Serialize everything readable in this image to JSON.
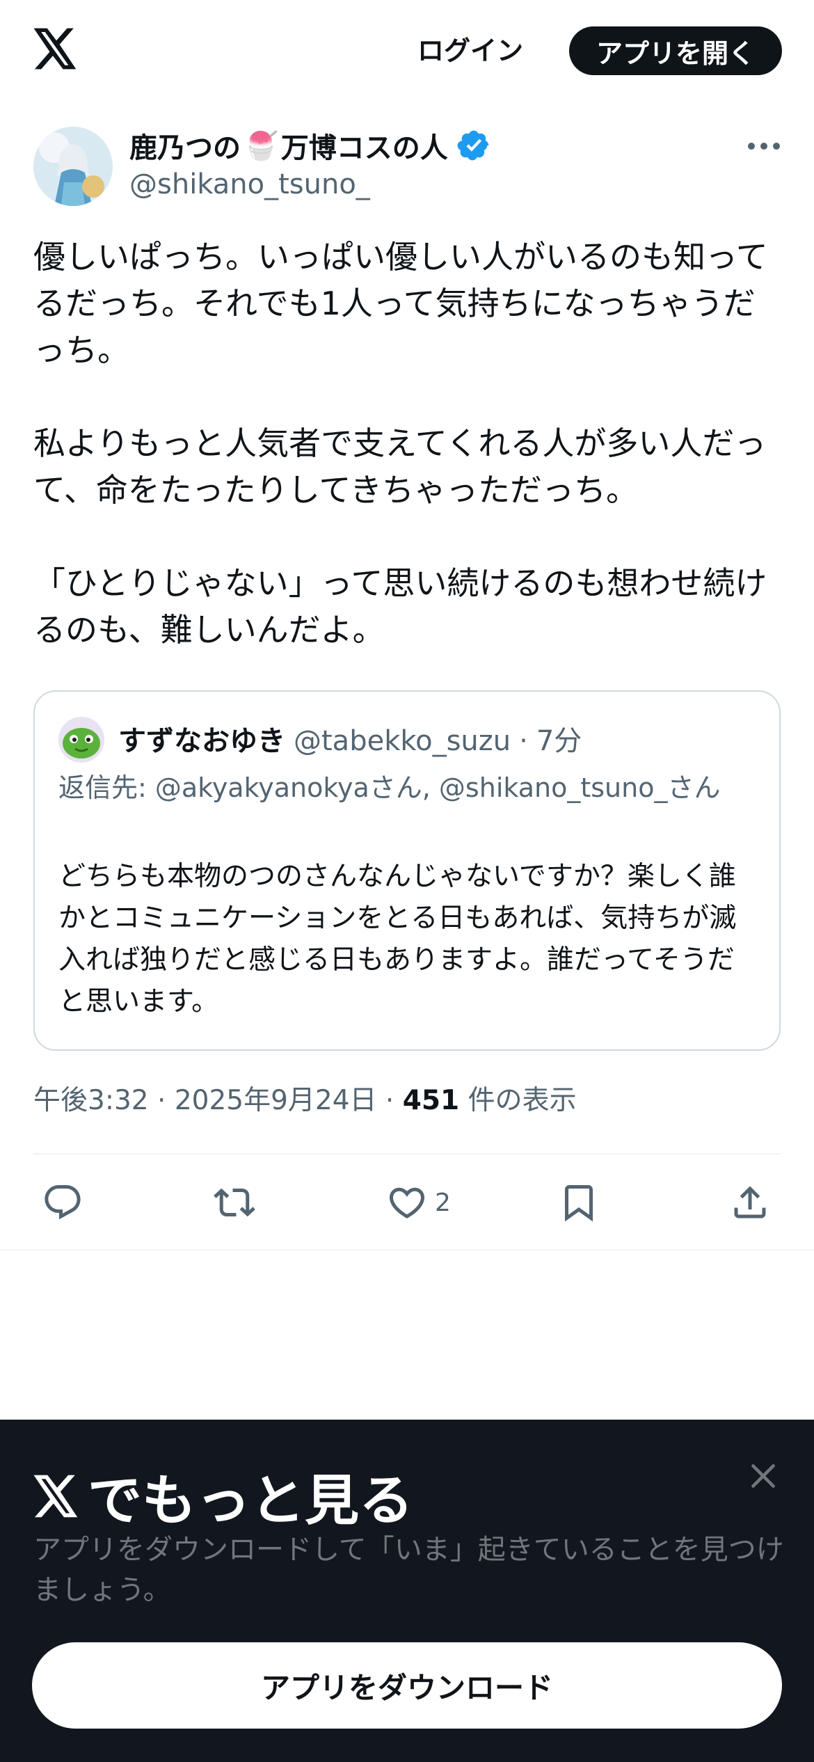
{
  "header": {
    "logo_icon": "x-logo-icon",
    "login_label": "ログイン",
    "open_app_label": "アプリを開く"
  },
  "author": {
    "name_part1": "鹿乃つの",
    "name_emoji": "🍧",
    "name_part2": "万博コスの人",
    "handle": "@shikano_tsuno_",
    "verified_icon": "verified-badge-icon",
    "verified_color": "#1d9bf0"
  },
  "tweet": {
    "text": "優しいぱっち。いっぱい優しい人がいるのも知ってるだっち。それでも1人って気持ちになっちゃうだっち。\n\n私よりもっと人気者で支えてくれる人が多い人だって、命をたったりしてきちゃっただっち。\n\n「ひとりじゃない」って思い続けるのも想わせ続けるのも、難しいんだよ。"
  },
  "quote": {
    "name": "すずなおゆき",
    "handle": "@tabekko_suzu",
    "separator": "·",
    "time": "7分",
    "reply_to": "返信先: @akyakyanokyaさん, @shikano_tsuno_さん",
    "text": "どちらも本物のつのさんなんじゃないですか？楽しく誰かとコミュニケーションをとる日もあれば、気持ちが滅入れば独りだと感じる日もありますよ。誰だってそうだと思います。"
  },
  "meta": {
    "time": "午後3:32",
    "date": "2025年9月24日",
    "separator": "·",
    "views": "451",
    "views_label": "件の表示"
  },
  "actions": {
    "reply_icon": "reply-icon",
    "retweet_icon": "retweet-icon",
    "like_icon": "heart-icon",
    "like_count": "2",
    "bookmark_icon": "bookmark-icon",
    "share_icon": "share-icon"
  },
  "promo": {
    "title": "でもっと見る",
    "subtitle": "アプリをダウンロードして「いま」起きていることを見つけましょう。",
    "download_label": "アプリをダウンロード",
    "close_icon": "close-icon",
    "background": "#12171f"
  }
}
